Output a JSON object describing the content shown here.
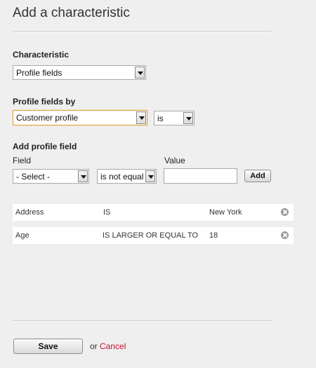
{
  "title": "Add a characteristic",
  "characteristic": {
    "label": "Characteristic",
    "selected": "Profile fields"
  },
  "profile_fields_by": {
    "label": "Profile fields by",
    "selected": "Customer profile",
    "operator": "is"
  },
  "add_profile_field": {
    "label": "Add profile field",
    "field_label": "Field",
    "value_label": "Value",
    "field_selected": "- Select -",
    "operator_selected": "is not equal",
    "value": "",
    "add_button": "Add"
  },
  "rules": [
    {
      "field": "Address",
      "operator": "IS",
      "value": "New York"
    },
    {
      "field": "Age",
      "operator": "IS LARGER OR EQUAL TO",
      "value": "18"
    }
  ],
  "footer": {
    "save_button": "Save",
    "or_text": "or",
    "cancel_link": "Cancel"
  }
}
